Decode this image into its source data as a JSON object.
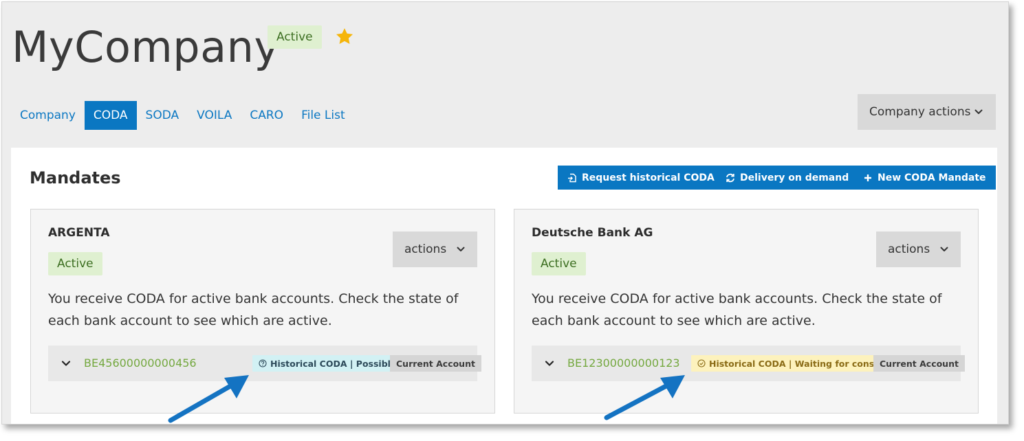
{
  "company": {
    "name": "MyCompany",
    "status": "Active"
  },
  "tabs": [
    {
      "label": "Company",
      "active": false
    },
    {
      "label": "CODA",
      "active": true
    },
    {
      "label": "SODA",
      "active": false
    },
    {
      "label": "VOILA",
      "active": false
    },
    {
      "label": "CARO",
      "active": false
    },
    {
      "label": "File List",
      "active": false
    }
  ],
  "company_actions_label": "Company actions",
  "mandates": {
    "title": "Mandates",
    "buttons": {
      "request_historical": "Request historical CODA",
      "delivery_on_demand": "Delivery on demand",
      "new_mandate": "New CODA Mandate"
    },
    "cards": [
      {
        "bank": "ARGENTA",
        "status": "Active",
        "actions_label": "actions",
        "description": "You receive CODA for active bank accounts. Check the state of each bank account to see which are active.",
        "account": {
          "iban": "BE45600000000456",
          "historical": "Historical CODA | Possible",
          "type": "Current Account"
        }
      },
      {
        "bank": "Deutsche Bank AG",
        "status": "Active",
        "actions_label": "actions",
        "description": "You receive CODA for active bank accounts. Check the state of each bank account to see which are active.",
        "account": {
          "iban": "BE12300000000123",
          "historical": "Historical CODA | Waiting for consent",
          "type": "Current Account"
        }
      }
    ]
  },
  "colors": {
    "primary": "#0a77c2",
    "active_badge_bg": "#dff0d0",
    "possible_badge_bg": "#d2f1f4",
    "waiting_badge_bg": "#fdf2bd",
    "iban_green": "#74a83f",
    "star": "#f5b50a",
    "annotation_arrow": "#1473c2"
  },
  "icons": {
    "favorite": "star-icon",
    "request_historical": "file-import-icon",
    "delivery": "refresh-icon",
    "new": "plus-icon",
    "possible": "question-circle-icon",
    "waiting": "clock-icon",
    "expand": "chevron-down-icon"
  }
}
